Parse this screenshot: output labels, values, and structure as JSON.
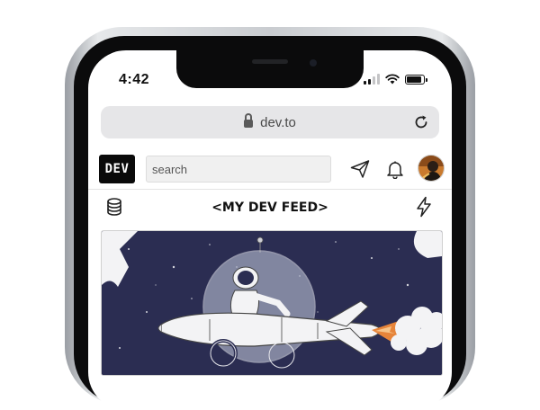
{
  "status_bar": {
    "time": "4:42"
  },
  "browser": {
    "url": "dev.to"
  },
  "dev_header": {
    "logo": "DEV",
    "search_placeholder": "search",
    "icons": [
      "send-icon",
      "bell-icon",
      "avatar"
    ]
  },
  "feed": {
    "title": "<MY DEV FEED>",
    "left_icon": "database-icon",
    "right_icon": "lightning-icon"
  },
  "colors": {
    "accent_dark": "#0a0a0a",
    "cover_background": "#2b2d52",
    "rocket_flame": "#e6843a"
  }
}
